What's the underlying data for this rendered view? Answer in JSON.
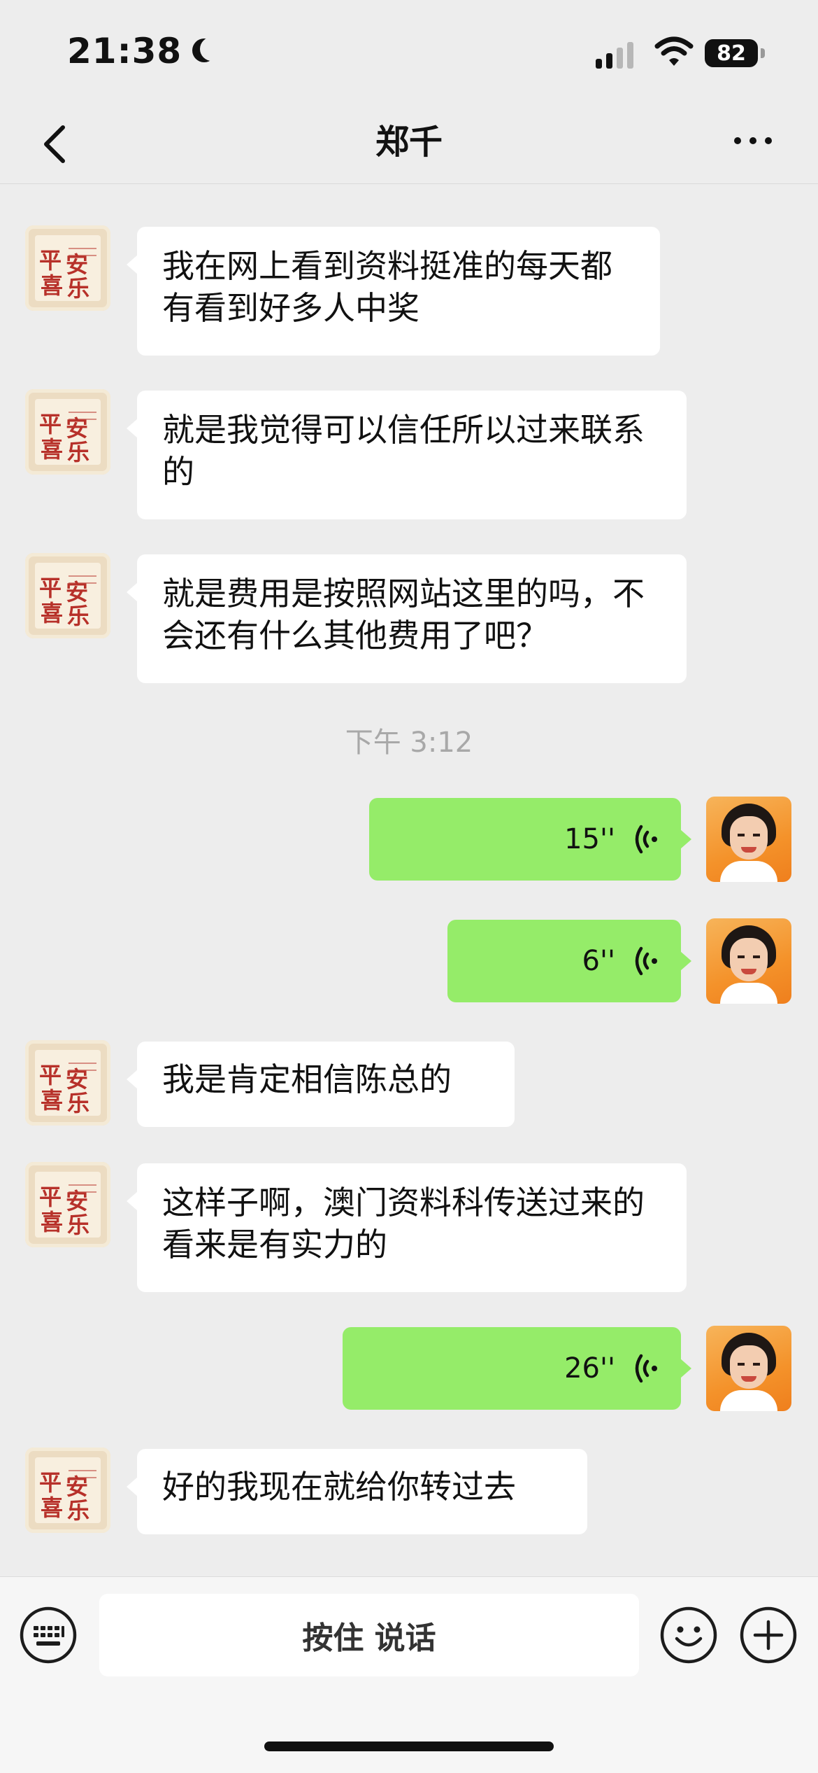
{
  "status_bar": {
    "time": "21:38",
    "battery": "82"
  },
  "nav": {
    "title": "郑千"
  },
  "messages": [
    {
      "from": "them",
      "text": "我在网上看到资料挺准的每天都有看到好多人中奖"
    },
    {
      "from": "them",
      "text": "就是我觉得可以信任所以过来联系的"
    },
    {
      "from": "them",
      "text": "就是费用是按照网站这里的吗，不会还有什么其他费用了吧？"
    },
    {
      "from": "me",
      "type": "voice",
      "duration": "15''"
    },
    {
      "from": "me",
      "type": "voice",
      "duration": "6''"
    },
    {
      "from": "them",
      "text": "我是肯定相信陈总的"
    },
    {
      "from": "them",
      "text": "这样子啊，澳门资料科传送过来的看来是有实力的"
    },
    {
      "from": "me",
      "type": "voice",
      "duration": "26''"
    },
    {
      "from": "them",
      "text": "好的我现在就给你转过去"
    }
  ],
  "timestamp": "下午 3:12",
  "avatar_art_text": [
    "平",
    "安",
    "喜",
    "乐"
  ],
  "input_bar": {
    "hold_to_talk": "按住 说话"
  }
}
